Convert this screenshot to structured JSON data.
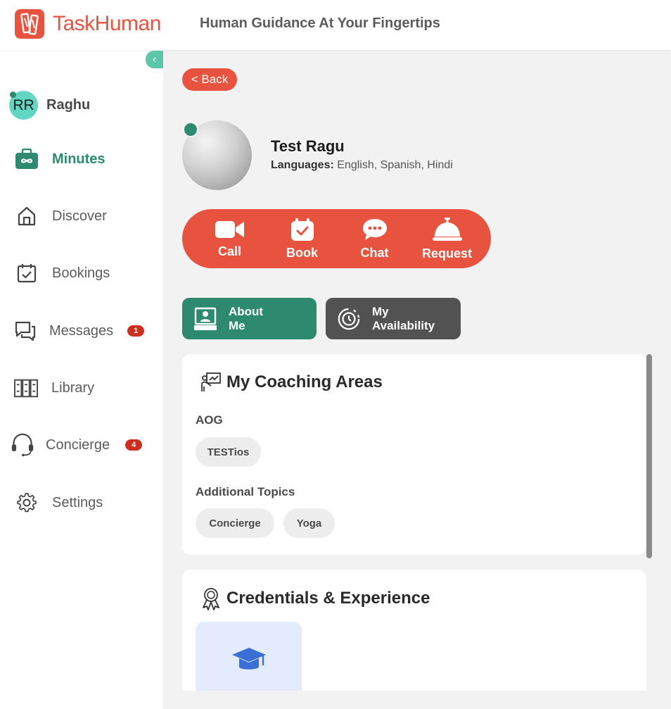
{
  "app": {
    "brand": "TaskHuman",
    "tagline": "Human Guidance At Your Fingertips",
    "brand_color": "#e8533f",
    "accent_color": "#2d8a6e"
  },
  "sidebar": {
    "collapse_icon": "chevron-left-icon",
    "user": {
      "initials": "RR",
      "name": "Raghu"
    },
    "items": [
      {
        "label": "Minutes",
        "icon": "minutes-icon",
        "active": true
      },
      {
        "label": "Discover",
        "icon": "home-icon"
      },
      {
        "label": "Bookings",
        "icon": "calendar-check-icon"
      },
      {
        "label": "Messages",
        "icon": "chat-bubbles-icon",
        "badge": "1"
      },
      {
        "label": "Library",
        "icon": "library-icon"
      },
      {
        "label": "Concierge",
        "icon": "headset-icon",
        "badge": "4"
      },
      {
        "label": "Settings",
        "icon": "gear-icon"
      }
    ]
  },
  "main": {
    "back_label": "< Back",
    "coach": {
      "name": "Test Ragu",
      "languages_label": "Languages:",
      "languages": "English, Spanish, Hindi"
    },
    "actions": [
      {
        "label": "Call",
        "icon": "video-camera-icon"
      },
      {
        "label": "Book",
        "icon": "calendar-icon"
      },
      {
        "label": "Chat",
        "icon": "chat-icon"
      },
      {
        "label": "Request",
        "icon": "service-bell-icon"
      }
    ],
    "tabs": [
      {
        "label_line1": "About",
        "label_line2": "Me",
        "icon": "profile-card-icon",
        "active": true
      },
      {
        "label_line1": "My",
        "label_line2": "Availability",
        "icon": "clock-icon"
      }
    ],
    "coaching_card": {
      "title": "My Coaching Areas",
      "sections": [
        {
          "label": "AOG",
          "chips": [
            "TESTios"
          ]
        },
        {
          "label": "Additional Topics",
          "chips": [
            "Concierge",
            "Yoga"
          ]
        }
      ]
    },
    "credentials_card": {
      "title": "Credentials & Experience",
      "tile_icon": "graduation-cap-icon"
    }
  }
}
